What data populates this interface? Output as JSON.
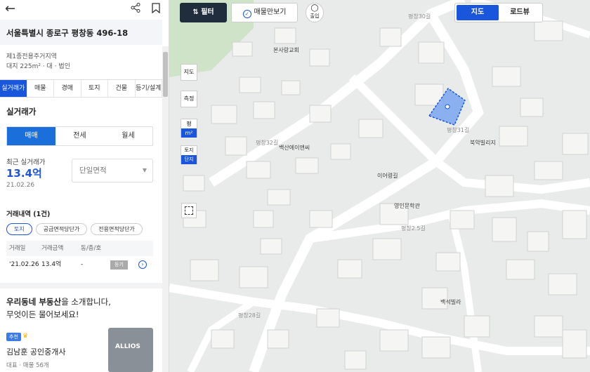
{
  "header": {
    "back_icon": "arrow-left-icon",
    "share_icon": "share-icon",
    "bookmark_icon": "bookmark-icon"
  },
  "address": "서울특별시 종로구 평창동 496-18",
  "zone": {
    "line1": "제1종전용주거지역",
    "line2": "대지 225m² · 대 · 법인"
  },
  "tabs": [
    "실거래가",
    "매물",
    "경매",
    "토지",
    "건물",
    "등기/설계"
  ],
  "active_tab": 0,
  "section_title": "실거래가",
  "deal_types": [
    "매매",
    "전세",
    "월세"
  ],
  "recent": {
    "label": "최근 실거래가",
    "price": "13.4억",
    "date": "21.02.26"
  },
  "area_select": {
    "value": "단일면적"
  },
  "history": {
    "title": "거래내역 (1건)",
    "chips": [
      "토지",
      "공급면적당단가",
      "전용면적당단가"
    ],
    "columns": [
      "거래일",
      "거래금액",
      "동/층/호"
    ],
    "rows": [
      {
        "date": "'21.02.26",
        "amount": "13.4억",
        "unit": "-",
        "badge": "등기"
      }
    ]
  },
  "promo": {
    "line1_bold": "우리동네 부동산",
    "line1_rest": "을 소개합니다,",
    "line2": "무엇이든 물어보세요!"
  },
  "agent": {
    "badge": "추천",
    "name": "김남훈 공인중개사",
    "sub": "대표 · 매물 56개",
    "logo": "ALLIOS"
  },
  "map": {
    "filter_label": "필터",
    "only_listings_label": "매물만보기",
    "chul_label": "출입",
    "map_types": [
      "지도",
      "로드뷰"
    ],
    "active_map_type": 0,
    "zoom_in_label": "지도",
    "distance_label": "측정",
    "unit_labels": [
      "평",
      "m²"
    ],
    "area_labels": [
      "토지",
      "단지"
    ],
    "select_icon": "area-select-icon",
    "pois": [
      "본사랑교회",
      "백산에이앤씨",
      "이어령길",
      "영인문학관",
      "북악빌리지",
      "백석빌라"
    ],
    "roads": [
      "평창30길",
      "평창32길",
      "평창2.5길",
      "평창31길",
      "평창28길"
    ],
    "accent": "#1a56db"
  }
}
